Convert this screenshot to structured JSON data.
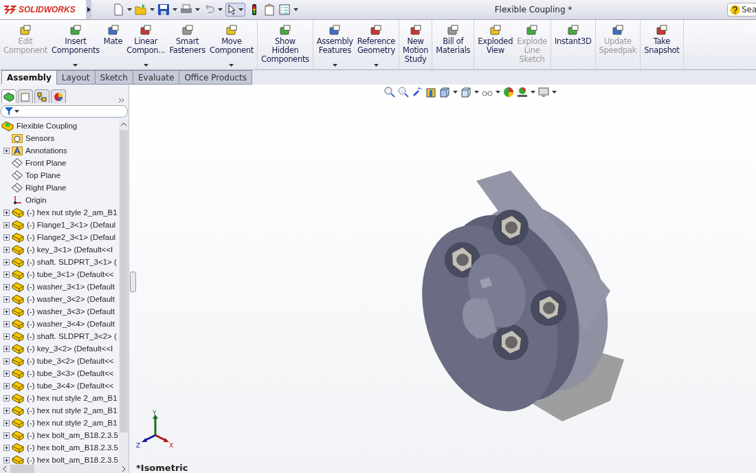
{
  "app": {
    "logo": "SOLIDWORKS",
    "title": "Flexible Coupling *",
    "search": {
      "placeholder": "Sea"
    }
  },
  "ribbon": {
    "groups": [
      [
        {
          "label": "Edit\nComponent",
          "disabled": true,
          "dropdown": false
        },
        {
          "label": "Insert\nComponents",
          "disabled": false,
          "dropdown": true
        },
        {
          "label": "Mate",
          "disabled": false,
          "dropdown": false
        },
        {
          "label": "Linear\nCompon...",
          "disabled": false,
          "dropdown": true
        },
        {
          "label": "Smart\nFasteners",
          "disabled": false,
          "dropdown": false
        },
        {
          "label": "Move\nComponent",
          "disabled": false,
          "dropdown": true
        }
      ],
      [
        {
          "label": "Show\nHidden\nComponents",
          "disabled": false,
          "dropdown": false
        }
      ],
      [
        {
          "label": "Assembly\nFeatures",
          "disabled": false,
          "dropdown": true
        },
        {
          "label": "Reference\nGeometry",
          "disabled": false,
          "dropdown": true
        }
      ],
      [
        {
          "label": "New\nMotion\nStudy",
          "disabled": false,
          "dropdown": false
        }
      ],
      [
        {
          "label": "Bill of\nMaterials",
          "disabled": false,
          "dropdown": false
        }
      ],
      [
        {
          "label": "Exploded\nView",
          "disabled": false,
          "dropdown": false
        },
        {
          "label": "Explode\nLine\nSketch",
          "disabled": true,
          "dropdown": false
        }
      ],
      [
        {
          "label": "Instant3D",
          "disabled": false,
          "dropdown": false
        }
      ],
      [
        {
          "label": "Update\nSpeedpak",
          "disabled": true,
          "dropdown": false
        }
      ],
      [
        {
          "label": "Take\nSnapshot",
          "disabled": false,
          "dropdown": false
        }
      ]
    ]
  },
  "tabs": [
    {
      "label": "Assembly",
      "selected": true
    },
    {
      "label": "Layout",
      "selected": false
    },
    {
      "label": "Sketch",
      "selected": false
    },
    {
      "label": "Evaluate",
      "selected": false
    },
    {
      "label": "Office Products",
      "selected": false
    }
  ],
  "panel_tabs": [
    {
      "selected": true
    },
    {
      "selected": false
    },
    {
      "selected": false
    },
    {
      "selected": false
    }
  ],
  "tree": {
    "label": "Flexible Coupling",
    "children": [
      {
        "label": "Sensors",
        "kind": "sensors",
        "expandable": false
      },
      {
        "label": "Annotations",
        "kind": "annotations",
        "expandable": true
      },
      {
        "label": "Front Plane",
        "kind": "plane",
        "expandable": false
      },
      {
        "label": "Top Plane",
        "kind": "plane",
        "expandable": false
      },
      {
        "label": "Right Plane",
        "kind": "plane",
        "expandable": false
      },
      {
        "label": "Origin",
        "kind": "origin",
        "expandable": false
      },
      {
        "label": "(-) hex nut style 2_am_B1",
        "kind": "part",
        "expandable": true
      },
      {
        "label": "(-) Flange1_3<1> (Defaul",
        "kind": "part",
        "expandable": true
      },
      {
        "label": "(-) Flange2_3<1> (Defaul",
        "kind": "part",
        "expandable": true
      },
      {
        "label": "(-) key_3<1> (Default<<I",
        "kind": "part",
        "expandable": true
      },
      {
        "label": "(-) shaft. SLDPRT_3<1> (",
        "kind": "part",
        "expandable": true
      },
      {
        "label": "(-) tube_3<1> (Default<<",
        "kind": "part",
        "expandable": true
      },
      {
        "label": "(-) washer_3<1> (Default",
        "kind": "part",
        "expandable": true
      },
      {
        "label": "(-) washer_3<2> (Default",
        "kind": "part",
        "expandable": true
      },
      {
        "label": "(-) washer_3<3> (Default",
        "kind": "part",
        "expandable": true
      },
      {
        "label": "(-) washer_3<4> (Default",
        "kind": "part",
        "expandable": true
      },
      {
        "label": "(-) shaft. SLDPRT_3<2> (",
        "kind": "part",
        "expandable": true
      },
      {
        "label": "(-) key_3<2> (Default<<I",
        "kind": "part",
        "expandable": true
      },
      {
        "label": "(-) tube_3<2> (Default<<",
        "kind": "part",
        "expandable": true
      },
      {
        "label": "(-) tube_3<3> (Default<<",
        "kind": "part",
        "expandable": true
      },
      {
        "label": "(-) tube_3<4> (Default<<",
        "kind": "part",
        "expandable": true
      },
      {
        "label": "(-) hex nut style 2_am_B1",
        "kind": "part",
        "expandable": true
      },
      {
        "label": "(-) hex nut style 2_am_B1",
        "kind": "part",
        "expandable": true
      },
      {
        "label": "(-) hex nut style 2_am_B1",
        "kind": "part",
        "expandable": true
      },
      {
        "label": "(-) hex bolt_am_B18.2.3.5",
        "kind": "part",
        "expandable": true
      },
      {
        "label": "(-) hex bolt_am_B18.2.3.5",
        "kind": "part",
        "expandable": true
      },
      {
        "label": "(-) hex bolt_am_B18.2.3.5",
        "kind": "part",
        "expandable": true
      }
    ]
  },
  "viewport": {
    "triad": {
      "x": "X",
      "y": "Y",
      "z": "Z"
    },
    "view_name": "*Isometric"
  }
}
